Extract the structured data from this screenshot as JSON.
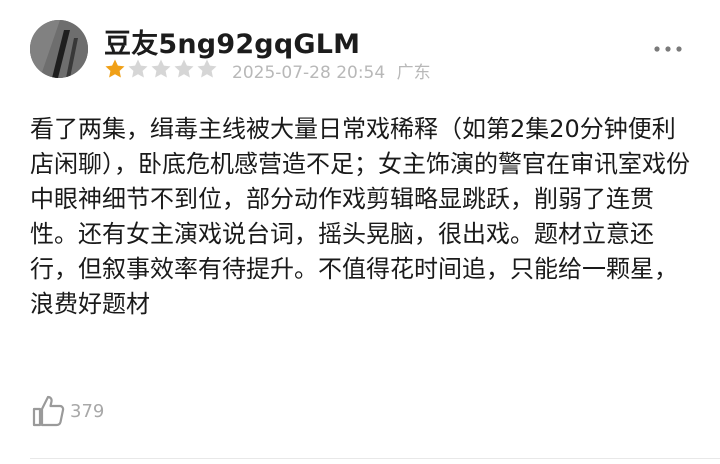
{
  "review": {
    "username": "豆友5ng92gqGLM",
    "rating": {
      "filled": 1,
      "total": 5
    },
    "date": "2025-07-28 20:54",
    "location": "广东",
    "body": "看了两集，缉毒主线被大量日常戏稀释（如第2集20分钟便利店闲聊），卧底危机感营造不足；女主饰演的警官在审讯室戏份中眼神细节不到位，部分动作戏剪辑略显跳跃，削弱了连贯性。还有女主演戏说台词，摇头晃脑，很出戏。题材立意还行，但叙事效率有待提升。不值得花时间追，只能给一颗星，浪费好题材",
    "likes": "379"
  },
  "icons": {
    "avatar": "avatar-photo",
    "star_filled": "star-filled-icon",
    "star_empty": "star-empty-icon",
    "more": "more-dots-icon",
    "like": "thumbs-up-icon"
  },
  "colors": {
    "star_filled": "#f0a017",
    "star_empty": "#d6d6d6",
    "meta_text": "#b8b8b8",
    "body_text": "#1a1a1a"
  }
}
